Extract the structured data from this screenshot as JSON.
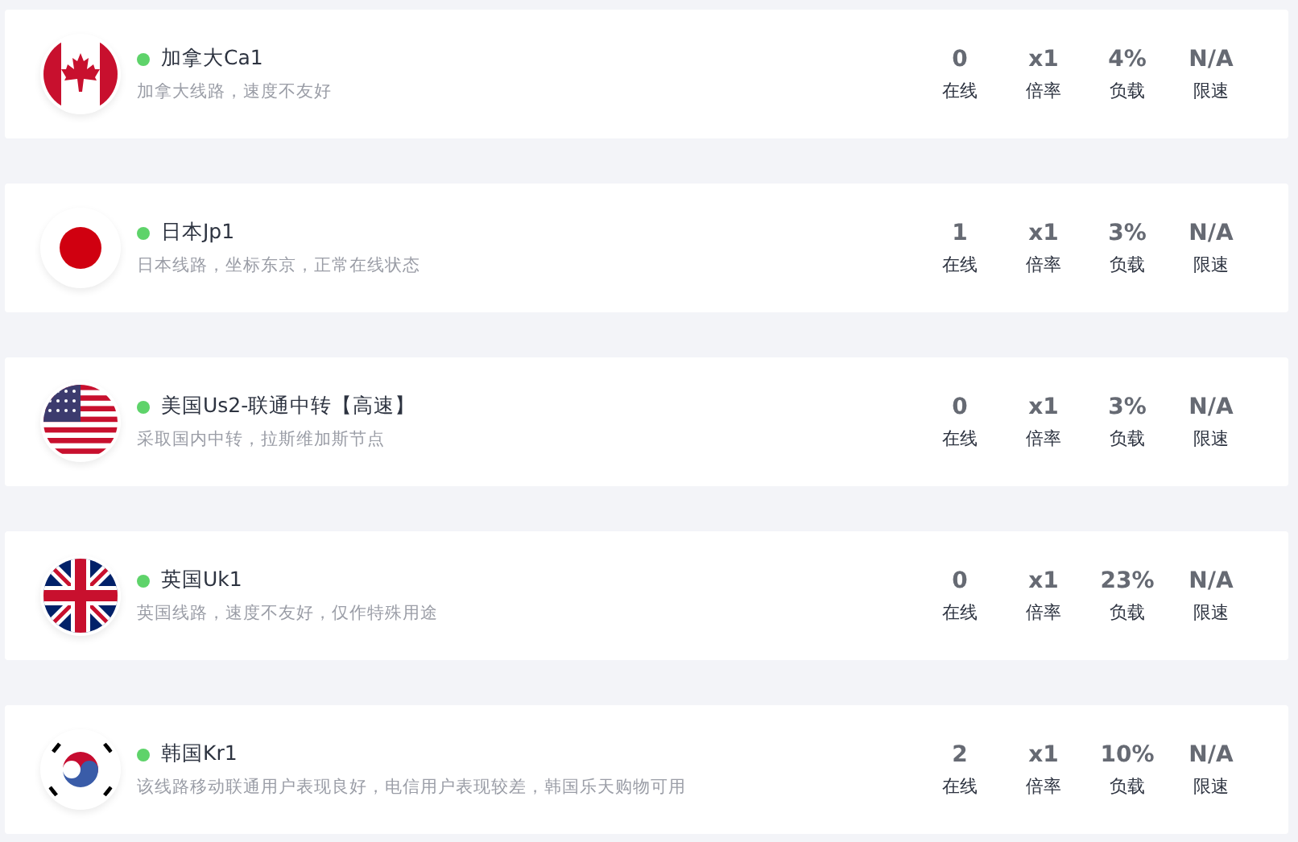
{
  "servers": [
    {
      "kind": "ca",
      "online": true,
      "name": "加拿大Ca1",
      "description": "加拿大线路，速度不友好",
      "stats": [
        {
          "value": "0",
          "label": "在线"
        },
        {
          "value": "x1",
          "label": "倍率"
        },
        {
          "value": "4%",
          "label": "负载"
        },
        {
          "value": "N/A",
          "label": "限速"
        }
      ]
    },
    {
      "kind": "jp",
      "online": true,
      "name": "日本Jp1",
      "description": "日本线路，坐标东京，正常在线状态",
      "stats": [
        {
          "value": "1",
          "label": "在线"
        },
        {
          "value": "x1",
          "label": "倍率"
        },
        {
          "value": "3%",
          "label": "负载"
        },
        {
          "value": "N/A",
          "label": "限速"
        }
      ]
    },
    {
      "kind": "us",
      "online": true,
      "name": "美国Us2-联通中转【高速】",
      "description": "采取国内中转，拉斯维加斯节点",
      "stats": [
        {
          "value": "0",
          "label": "在线"
        },
        {
          "value": "x1",
          "label": "倍率"
        },
        {
          "value": "3%",
          "label": "负载"
        },
        {
          "value": "N/A",
          "label": "限速"
        }
      ]
    },
    {
      "kind": "uk",
      "online": true,
      "name": "英国Uk1",
      "description": "英国线路，速度不友好，仅作特殊用途",
      "stats": [
        {
          "value": "0",
          "label": "在线"
        },
        {
          "value": "x1",
          "label": "倍率"
        },
        {
          "value": "23%",
          "label": "负载"
        },
        {
          "value": "N/A",
          "label": "限速"
        }
      ]
    },
    {
      "kind": "kr",
      "online": true,
      "name": "韩国Kr1",
      "description": "该线路移动联通用户表现良好，电信用户表现较差，韩国乐天购物可用",
      "stats": [
        {
          "value": "2",
          "label": "在线"
        },
        {
          "value": "x1",
          "label": "倍率"
        },
        {
          "value": "10%",
          "label": "负载"
        },
        {
          "value": "N/A",
          "label": "限速"
        }
      ]
    }
  ]
}
